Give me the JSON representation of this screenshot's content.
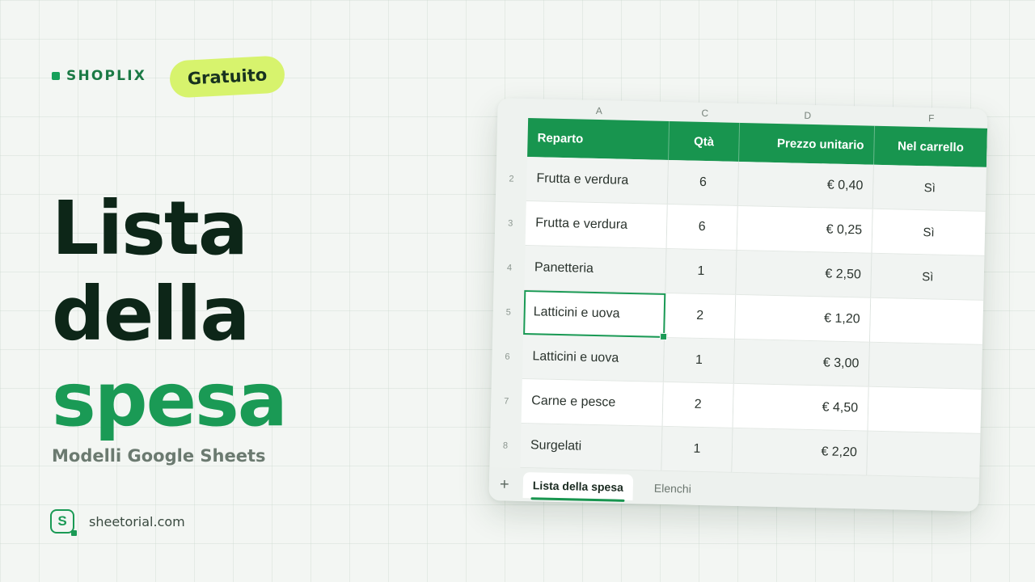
{
  "brand": {
    "name": "SHOPLIX",
    "badge": "Gratuito"
  },
  "title": {
    "line1": "Lista",
    "line2": "della",
    "line3": "spesa"
  },
  "subtitle": "Modelli Google Sheets",
  "site": {
    "logo_letter": "S",
    "url": "sheetorial.com"
  },
  "colors": {
    "accent": "#1a9a55",
    "header": "#18954f",
    "badge": "#d7f36d",
    "title": "#0d2618"
  },
  "sheet": {
    "column_letters": [
      "A",
      "C",
      "D",
      "F"
    ],
    "headers": [
      "Reparto",
      "Qtà",
      "Prezzo unitario",
      "Nel carrello"
    ],
    "rows": [
      {
        "num": "2",
        "reparto": "Frutta e verdura",
        "qta": "6",
        "prezzo": "€ 0,40",
        "carrello": "Sì"
      },
      {
        "num": "3",
        "reparto": "Frutta e verdura",
        "qta": "6",
        "prezzo": "€ 0,25",
        "carrello": "Sì"
      },
      {
        "num": "4",
        "reparto": "Panetteria",
        "qta": "1",
        "prezzo": "€ 2,50",
        "carrello": "Sì"
      },
      {
        "num": "5",
        "reparto": "Latticini e uova",
        "qta": "2",
        "prezzo": "€ 1,20",
        "carrello": ""
      },
      {
        "num": "6",
        "reparto": "Latticini e uova",
        "qta": "1",
        "prezzo": "€ 3,00",
        "carrello": ""
      },
      {
        "num": "7",
        "reparto": "Carne e pesce",
        "qta": "2",
        "prezzo": "€ 4,50",
        "carrello": ""
      },
      {
        "num": "8",
        "reparto": "Surgelati",
        "qta": "1",
        "prezzo": "€ 2,20",
        "carrello": ""
      }
    ],
    "selected_row": 3,
    "add_sheet_icon": "plus-icon",
    "add_sheet_glyph": "+",
    "tabs": [
      {
        "label": "Lista della spesa",
        "active": true
      },
      {
        "label": "Elenchi",
        "active": false
      }
    ]
  }
}
